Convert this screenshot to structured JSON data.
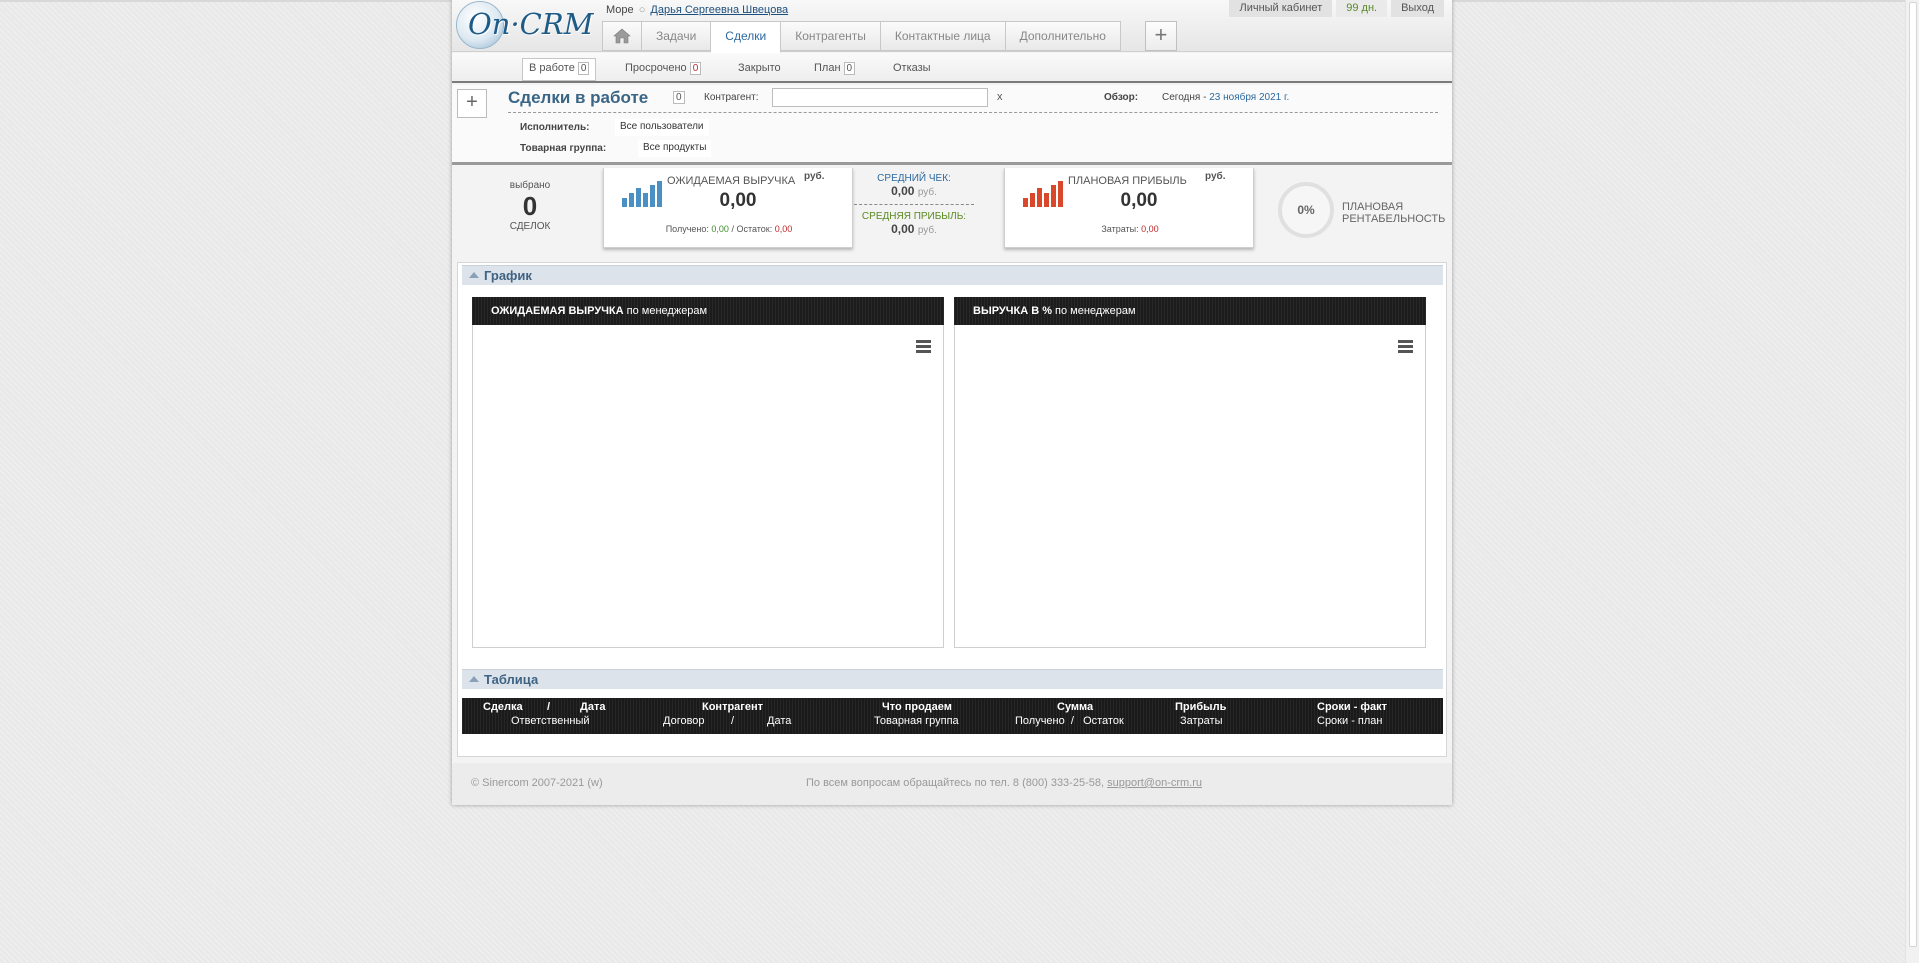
{
  "header": {
    "logo_text": "On·CRM",
    "breadcrumb_org": "Море",
    "breadcrumb_sep": "○",
    "breadcrumb_user": "Дарья Сергеевна Швецова",
    "nav_tabs": [
      {
        "label": "Задачи"
      },
      {
        "label": "Сделки"
      },
      {
        "label": "Контрагенты"
      },
      {
        "label": "Контактные лица"
      },
      {
        "label": "Дополнительно"
      }
    ],
    "account": {
      "cabinet": "Личный кабинет",
      "days": "99 дн.",
      "logout": "Выход"
    }
  },
  "subtabs": [
    {
      "label": "В работе",
      "count": "0"
    },
    {
      "label": "Просрочено",
      "count": "0"
    },
    {
      "label": "Закрыто"
    },
    {
      "label": "План",
      "count": "0"
    },
    {
      "label": "Отказы"
    }
  ],
  "filters": {
    "title": "Сделки в работе",
    "title_count": "0",
    "contractor_label": "Контрагент:",
    "contractor_value": "",
    "clear": "x",
    "overview_label": "Обзор:",
    "overview_prefix": "Сегодня - ",
    "overview_date": "23 ноября 2021 г.",
    "executor_label": "Исполнитель:",
    "executor_value": "Все пользователи",
    "group_label": "Товарная группа:",
    "group_value": "Все продукты"
  },
  "stats": {
    "selected_label": "выбрано",
    "selected_count": "0",
    "selected_unit": "СДЕЛОК",
    "revenue": {
      "title": "ОЖИДАЕМАЯ ВЫРУЧКА",
      "unit": "руб.",
      "value": "0,00",
      "received_label": "Получено:",
      "received": "0,00",
      "remaining_label": "/ Остаток:",
      "remaining": "0,00"
    },
    "avg_check_label": "СРЕДНИЙ ЧЕК:",
    "avg_check_value": "0,00",
    "avg_profit_label": "СРЕДНЯЯ ПРИБЫЛЬ:",
    "avg_profit_value": "0,00",
    "unit_small": "руб.",
    "profit": {
      "title": "ПЛАНОВАЯ ПРИБЫЛЬ",
      "unit": "руб.",
      "value": "0,00",
      "costs_label": "Затраты:",
      "costs": "0,00"
    },
    "rentability_value": "0%",
    "rentability_label_1": "ПЛАНОВАЯ",
    "rentability_label_2": "РЕНТАБЕЛЬНОСТЬ"
  },
  "graph_section": {
    "title": "График",
    "left_title_bold": "ОЖИДАЕМАЯ ВЫРУЧКА",
    "left_title_rest": "по менеджерам",
    "right_title_bold": "ВЫРУЧКА В %",
    "right_title_rest": "по менеджерам"
  },
  "table_section": {
    "title": "Таблица",
    "row1": [
      "Сделка",
      "/",
      "Дата",
      "Контрагент",
      "Что продаем",
      "Сумма",
      "Прибыль",
      "Сроки - факт"
    ],
    "row2": [
      "Ответственный",
      "Договор",
      "/",
      "Дата",
      "Товарная группа",
      "Получено  /   Остаток",
      "Затраты",
      "Сроки - план"
    ]
  },
  "footer": {
    "copyright": "© Sinercom 2007-2021 (w)",
    "contact_text": "По всем вопросам обращайтесь по тел. 8 (800) 333-25-58,",
    "contact_email": "support@on-crm.ru"
  },
  "colors": {
    "accent": "#2e6aa0",
    "revenue_bars": "#4a90c4",
    "profit_bars": "#d9482b",
    "positive": "#3f8d2c",
    "negative": "#c0282a"
  }
}
